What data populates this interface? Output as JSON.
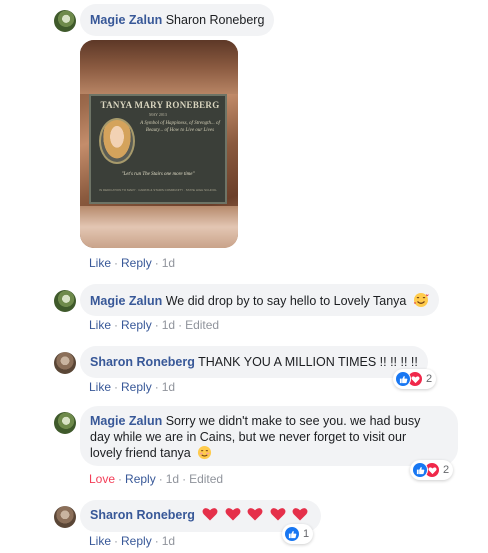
{
  "comments": [
    {
      "author": "Magie Zalun",
      "text": "Sharon Roneberg",
      "actions": {
        "like": "Like",
        "reply": "Reply",
        "time": "1d"
      },
      "photo": {
        "plaque_title": "TANYA MARY RONEBERG",
        "plaque_date": "MAY 2013",
        "plaque_verse": "A Symbol of Happiness, of Strength... of Beauty... of How to Live our Lives",
        "plaque_quote": "\"Let's run The Stairs one more time\"",
        "plaque_foot": "IN DEDICATION TO MARY · CAIRNS & STAIRS COMMUNITY · STATE HIGH SCHOOL"
      }
    },
    {
      "author": "Magie Zalun",
      "text": "We did drop by to say hello to Lovely Tanya",
      "emoji": "smiling-face-with-hearts",
      "actions": {
        "like": "Like",
        "reply": "Reply",
        "time": "1d",
        "edited": "Edited"
      }
    },
    {
      "author": "Sharon Roneberg",
      "text": "THANK YOU A MILLION TIMES !! !! !! !!",
      "actions": {
        "like": "Like",
        "reply": "Reply",
        "time": "1d"
      },
      "reactions": {
        "types": [
          "like",
          "love"
        ],
        "count": "2"
      }
    },
    {
      "author": "Magie Zalun",
      "text_line1": "Sorry we didn't make to see you. we had busy",
      "text_line2": "day while we are in Cains, but we never forget to visit our",
      "text_line3": "lovely friend tanya",
      "emoji": "smiling-face",
      "actions": {
        "like": "Love",
        "reply": "Reply",
        "time": "1d",
        "edited": "Edited"
      },
      "reactions": {
        "types": [
          "like",
          "love"
        ],
        "count": "2"
      }
    },
    {
      "author": "Sharon Roneberg",
      "emoji": "red-heart",
      "heart_count": 5,
      "actions": {
        "like": "Like",
        "reply": "Reply",
        "time": "1d"
      },
      "reactions": {
        "types": [
          "like"
        ],
        "count": "1"
      }
    }
  ],
  "colors": {
    "author": "#385898",
    "bubble": "#f2f3f5",
    "like_reaction": "#1877f2",
    "love_reaction": "#f0284a",
    "love_action": "#f33e58",
    "muted": "#90949c"
  }
}
